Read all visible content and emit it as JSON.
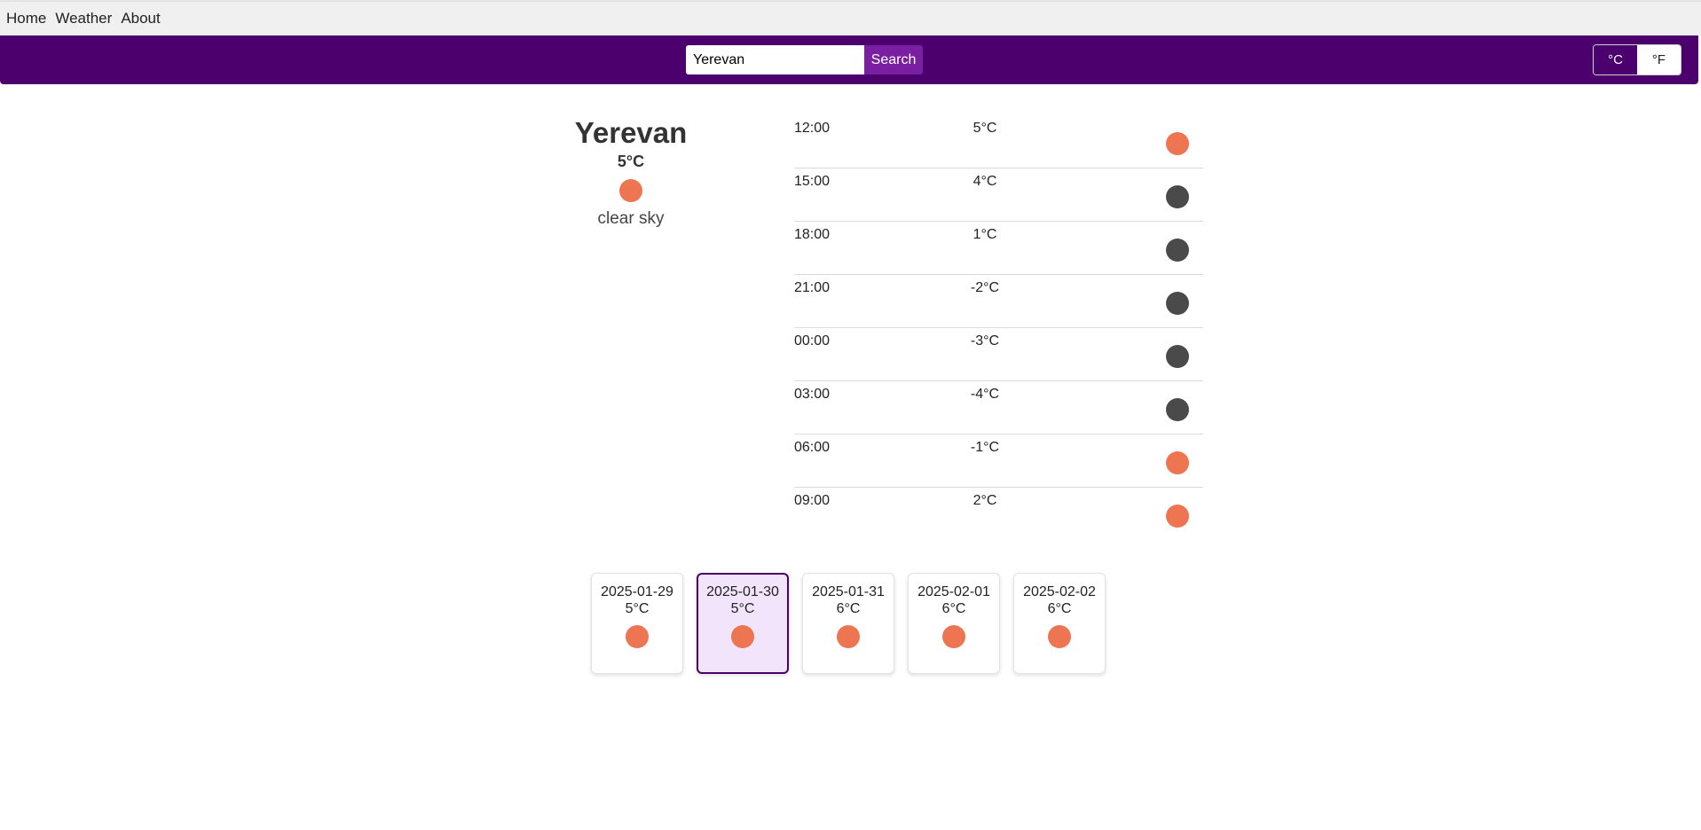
{
  "nav": {
    "items": [
      {
        "label": "Home"
      },
      {
        "label": "Weather"
      },
      {
        "label": "About"
      }
    ]
  },
  "search": {
    "value": "Yerevan",
    "button_label": "Search"
  },
  "units": {
    "celsius_label": "°C",
    "fahrenheit_label": "°F",
    "selected": "°C"
  },
  "current": {
    "city": "Yerevan",
    "temp": "5°C",
    "description": "clear sky",
    "icon": "sun-icon"
  },
  "hourly": [
    {
      "time": "12:00",
      "temp": "5°C",
      "icon": "sun-icon"
    },
    {
      "time": "15:00",
      "temp": "4°C",
      "icon": "moon-icon"
    },
    {
      "time": "18:00",
      "temp": "1°C",
      "icon": "moon-icon"
    },
    {
      "time": "21:00",
      "temp": "-2°C",
      "icon": "moon-icon"
    },
    {
      "time": "00:00",
      "temp": "-3°C",
      "icon": "moon-icon"
    },
    {
      "time": "03:00",
      "temp": "-4°C",
      "icon": "moon-icon"
    },
    {
      "time": "06:00",
      "temp": "-1°C",
      "icon": "sun-icon"
    },
    {
      "time": "09:00",
      "temp": "2°C",
      "icon": "sun-icon"
    }
  ],
  "daily": [
    {
      "date": "2025-01-29",
      "temp": "5°C",
      "icon": "sun-icon",
      "selected": false
    },
    {
      "date": "2025-01-30",
      "temp": "5°C",
      "icon": "sun-icon",
      "selected": true
    },
    {
      "date": "2025-01-31",
      "temp": "6°C",
      "icon": "sun-icon",
      "selected": false
    },
    {
      "date": "2025-02-01",
      "temp": "6°C",
      "icon": "sun-icon",
      "selected": false
    },
    {
      "date": "2025-02-02",
      "temp": "6°C",
      "icon": "sun-icon",
      "selected": false
    }
  ],
  "colors": {
    "brand": "#4b006e",
    "search_button": "#7b1fa2",
    "sun_icon": "#ed7551",
    "moon_icon": "#4a4a4a",
    "selected_card_bg": "#f1e4fb"
  }
}
